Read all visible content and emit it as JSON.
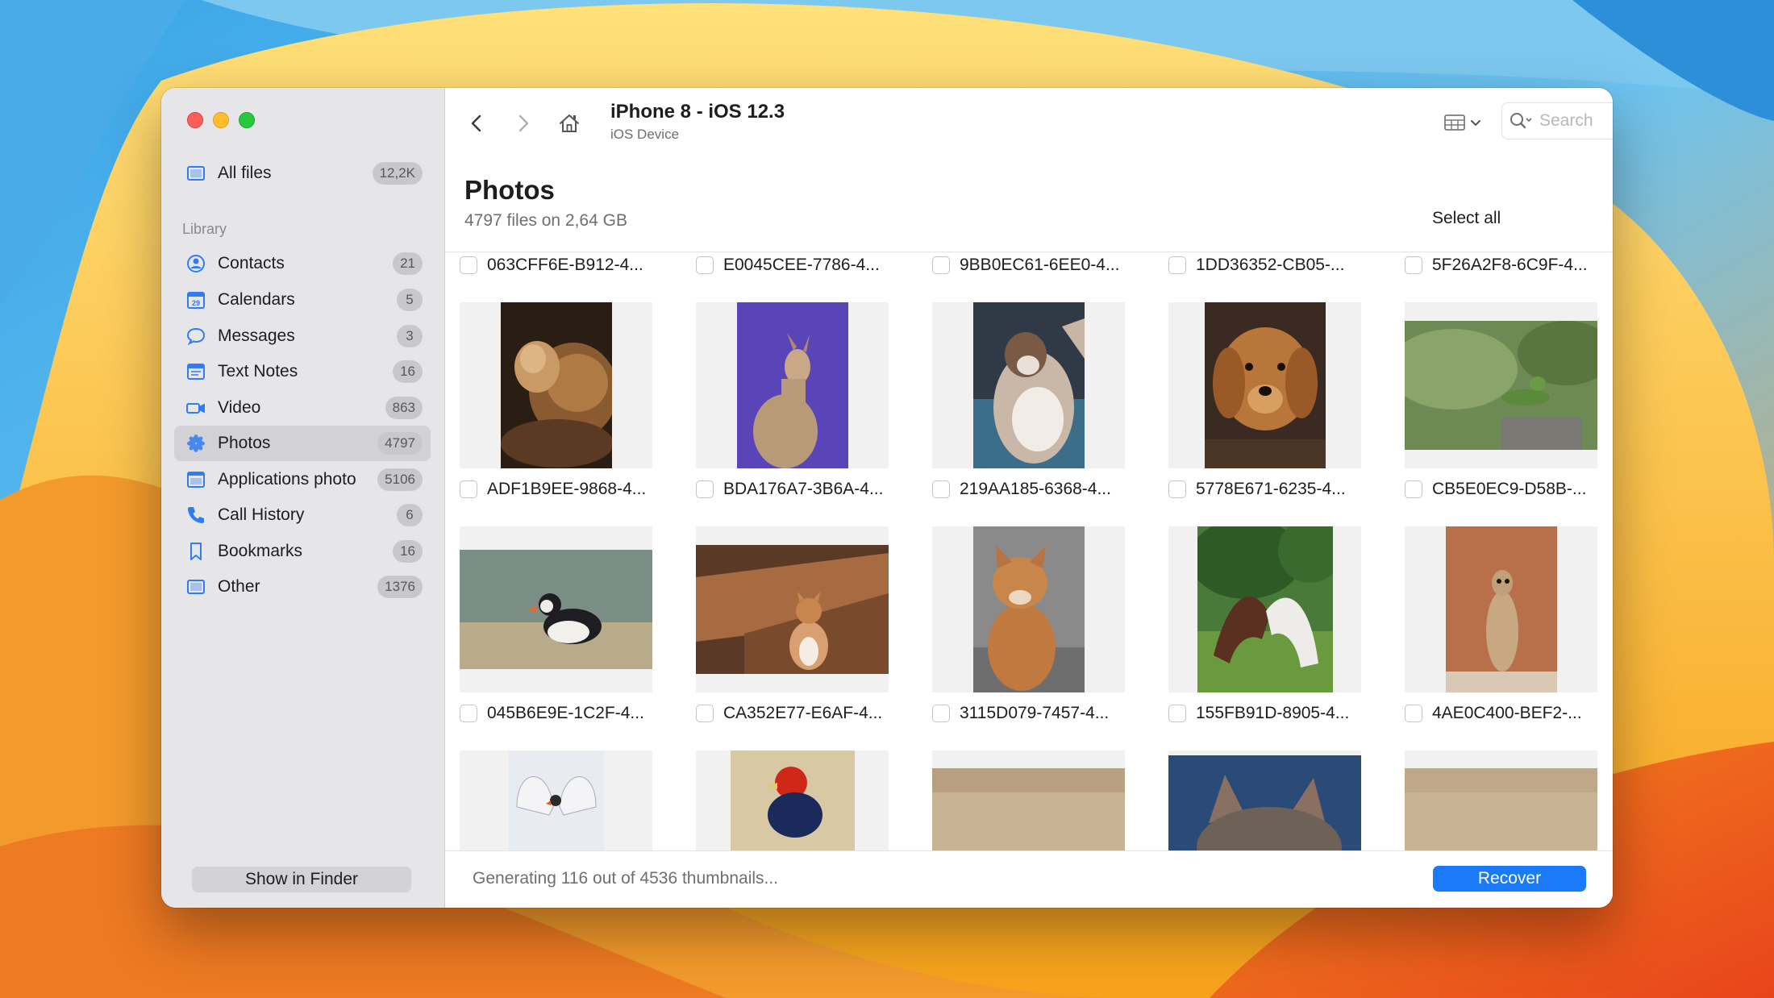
{
  "window": {
    "device_title": "iPhone 8 - iOS 12.3",
    "device_subtitle": "iOS Device",
    "search_placeholder": "Search"
  },
  "sidebar": {
    "all_files": {
      "label": "All files",
      "count": "12,2K",
      "icon": "all-files-icon"
    },
    "library_label": "Library",
    "items": [
      {
        "label": "Contacts",
        "count": "21",
        "icon": "contacts-icon",
        "color": "#2f7cf6"
      },
      {
        "label": "Calendars",
        "count": "5",
        "icon": "calendar-icon",
        "color": "#2f7cf6"
      },
      {
        "label": "Messages",
        "count": "3",
        "icon": "messages-icon",
        "color": "#2f7cf6"
      },
      {
        "label": "Text Notes",
        "count": "16",
        "icon": "notes-icon",
        "color": "#2f7cf6"
      },
      {
        "label": "Video",
        "count": "863",
        "icon": "video-icon",
        "color": "#2f7cf6"
      },
      {
        "label": "Photos",
        "count": "4797",
        "icon": "photos-icon",
        "color": "#2f7cf6",
        "active": true
      },
      {
        "label": "Applications photo",
        "count": "5106",
        "icon": "app-photo-icon",
        "color": "#2f7cf6"
      },
      {
        "label": "Call History",
        "count": "6",
        "icon": "phone-icon",
        "color": "#2f7cf6"
      },
      {
        "label": "Bookmarks",
        "count": "16",
        "icon": "bookmark-icon",
        "color": "#2f7cf6"
      },
      {
        "label": "Other",
        "count": "1376",
        "icon": "other-icon",
        "color": "#2f7cf6"
      }
    ],
    "show_in_finder": "Show in Finder"
  },
  "content": {
    "title": "Photos",
    "subtitle": "4797 files on 2,64 GB",
    "select_all": "Select all"
  },
  "rows": [
    [
      "063CFF6E-B912-4...",
      "E0045CEE-7786-4...",
      "9BB0EC61-6EE0-4...",
      "1DD36352-CB05-...",
      "5F26A2F8-6C9F-4..."
    ],
    [
      "ADF1B9EE-9868-4...",
      "BDA176A7-3B6A-4...",
      "219AA185-6368-4...",
      "5778E671-6235-4...",
      "CB5E0EC9-D58B-..."
    ],
    [
      "045B6E9E-1C2F-4...",
      "CA352E77-E6AF-4...",
      "3115D079-7457-4...",
      "155FB91D-8905-4...",
      "4AE0C400-BEF2-..."
    ]
  ],
  "photos": {
    "row2": [
      "lions",
      "dog-violet",
      "cat-fluffy",
      "golden-dog",
      "lizard"
    ],
    "row3": [
      "puffin",
      "cat-floor",
      "tabby-cat",
      "horses",
      "meerkat"
    ],
    "row4": [
      "swans",
      "pheasant",
      "blur-beige",
      "cat-blue",
      "blur-beige"
    ]
  },
  "status": {
    "text": "Generating 116 out of 4536 thumbnails...",
    "recover": "Recover"
  },
  "colors": {
    "accent": "#1a7af8",
    "sidebar_bg": "#e6e6e8",
    "close": "#fe5f57",
    "minimize": "#febc2e",
    "maximize": "#28c840"
  }
}
